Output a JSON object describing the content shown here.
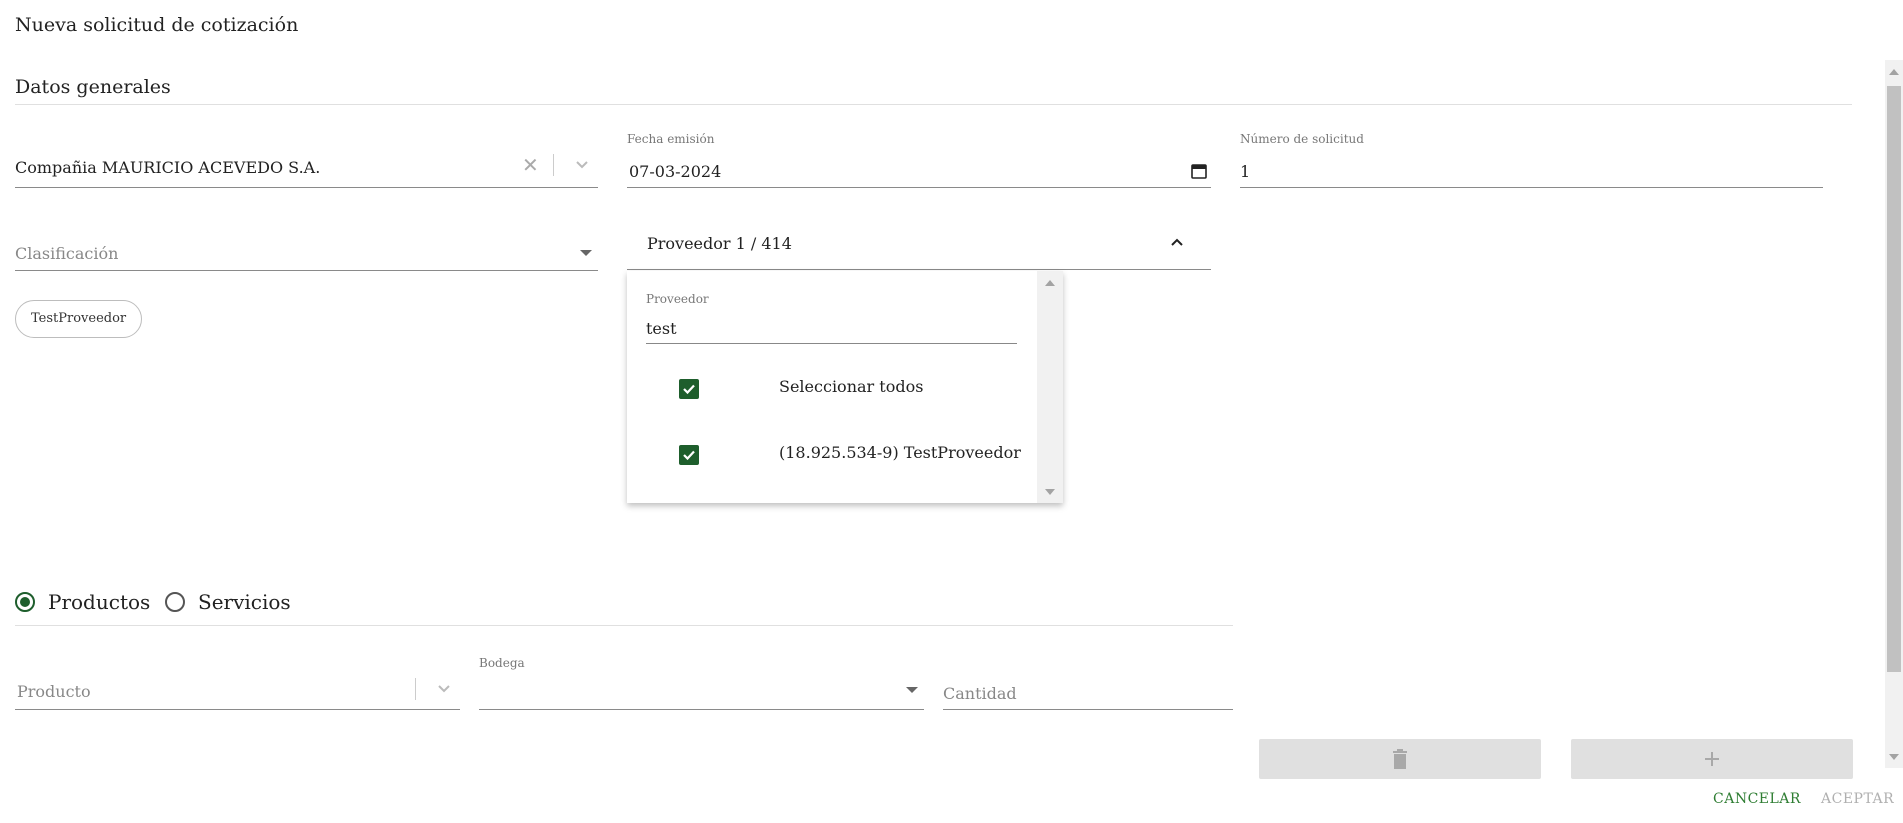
{
  "dialog": {
    "title": "Nueva solicitud de cotización"
  },
  "section": {
    "title": "Datos generales"
  },
  "company": {
    "value": "Compañia MAURICIO ACEVEDO S.A."
  },
  "emission_date": {
    "label": "Fecha emisión",
    "value": "07-03-2024"
  },
  "request_number": {
    "label": "Número de solicitud",
    "value": "1"
  },
  "classification": {
    "placeholder": "Clasificación"
  },
  "provider_select": {
    "value": "Proveedor 1 / 414"
  },
  "chip": {
    "label": "TestProveedor"
  },
  "provider_dropdown": {
    "search_label": "Proveedor",
    "search_value": "test",
    "items": [
      {
        "label": "Seleccionar todos",
        "checked": true
      },
      {
        "label": "(18.925.534-9) TestProveedor",
        "checked": true
      }
    ]
  },
  "type_radio": {
    "options": [
      {
        "label": "Productos",
        "checked": true
      },
      {
        "label": "Servicios",
        "checked": false
      }
    ]
  },
  "product": {
    "placeholder": "Producto"
  },
  "bodega": {
    "label": "Bodega",
    "value": ""
  },
  "quantity": {
    "placeholder": "Cantidad"
  },
  "footer": {
    "cancel_label": "CANCELAR",
    "accept_label": "ACEPTAR"
  },
  "colors": {
    "accent": "#1e5e2c",
    "cancel": "#2e7d32",
    "disabled": "#e0e0e0"
  },
  "icons": [
    "close-icon",
    "chevron-down-icon",
    "calendar-icon",
    "chevron-up-icon",
    "check-icon",
    "trash-icon",
    "plus-icon"
  ]
}
